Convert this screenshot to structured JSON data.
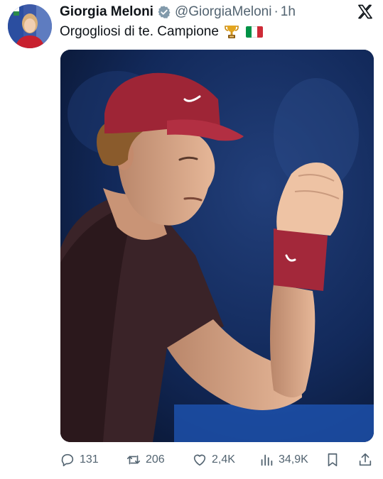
{
  "author": {
    "name": "Giorgia Meloni",
    "handle": "@GiorgiaMeloni",
    "separator": "·",
    "time": "1h"
  },
  "tweet": {
    "text": "Orgogliosi di te. Campione",
    "emoji_icons": [
      "trophy-icon",
      "italian-flag-icon"
    ]
  },
  "flag_colors": [
    "#009246",
    "#ffffff",
    "#ce2b37"
  ],
  "colors": {
    "text": "#0f1419",
    "muted": "#536471",
    "verified": "#829aab",
    "cap": "#a3283a"
  },
  "actions": {
    "replies": "131",
    "reposts": "206",
    "likes": "2,4K",
    "views": "34,9K"
  }
}
